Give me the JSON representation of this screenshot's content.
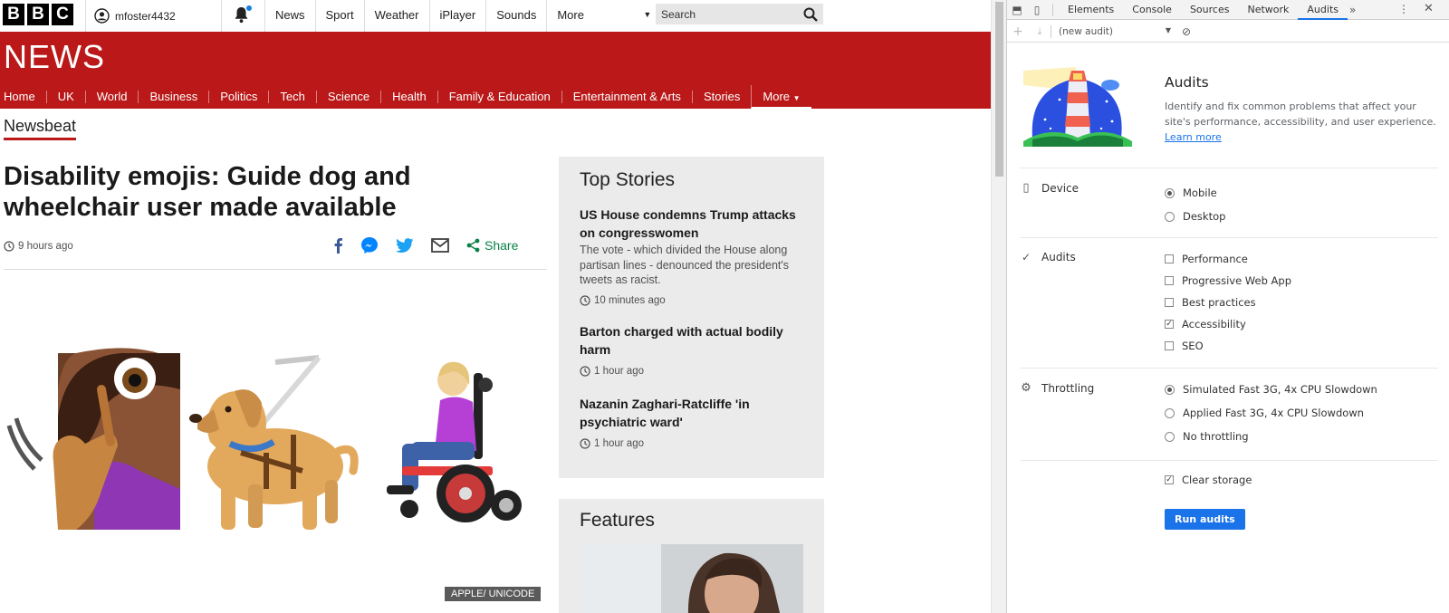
{
  "bbc": {
    "logo_letters": [
      "B",
      "B",
      "C"
    ],
    "account_name": "mfoster4432",
    "global_nav": [
      {
        "label": "News"
      },
      {
        "label": "Sport"
      },
      {
        "label": "Weather"
      },
      {
        "label": "iPlayer"
      },
      {
        "label": "Sounds"
      }
    ],
    "global_more": "More",
    "search_placeholder": "Search"
  },
  "news": {
    "logo_text": "NEWS",
    "brand_color": "#bb1919",
    "nav": [
      {
        "label": "Home"
      },
      {
        "label": "UK"
      },
      {
        "label": "World"
      },
      {
        "label": "Business"
      },
      {
        "label": "Politics"
      },
      {
        "label": "Tech"
      },
      {
        "label": "Science"
      },
      {
        "label": "Health"
      },
      {
        "label": "Family & Education"
      },
      {
        "label": "Entertainment & Arts"
      },
      {
        "label": "Stories"
      }
    ],
    "nav_more": "More"
  },
  "article": {
    "section": "Newsbeat",
    "headline": "Disability emojis: Guide dog and wheelchair user made available",
    "timestamp": "9 hours ago",
    "share_label": "Share",
    "image_credit": "APPLE/ UNICODE"
  },
  "top_stories": {
    "title": "Top Stories",
    "items": [
      {
        "title": "US House condemns Trump attacks on congresswomen",
        "summary": "The vote - which divided the House along partisan lines - denounced the president's tweets as racist.",
        "time": "10 minutes ago"
      },
      {
        "title": "Barton charged with actual bodily harm",
        "summary": "",
        "time": "1 hour ago"
      },
      {
        "title": "Nazanin Zaghari-Ratcliffe 'in psychiatric ward'",
        "summary": "",
        "time": "1 hour ago"
      }
    ]
  },
  "features": {
    "title": "Features"
  },
  "devtools": {
    "tabs": [
      "Elements",
      "Console",
      "Sources",
      "Network",
      "Audits"
    ],
    "active_tab": "Audits",
    "audit_select": "(new audit)",
    "panel_title": "Audits",
    "description": "Identify and fix common problems that affect your site's performance, accessibility, and user experience.",
    "learn_more": "Learn more",
    "device": {
      "label": "Device",
      "options": [
        {
          "label": "Mobile",
          "selected": true
        },
        {
          "label": "Desktop",
          "selected": false
        }
      ]
    },
    "audits": {
      "label": "Audits",
      "options": [
        {
          "label": "Performance",
          "checked": false
        },
        {
          "label": "Progressive Web App",
          "checked": false
        },
        {
          "label": "Best practices",
          "checked": false
        },
        {
          "label": "Accessibility",
          "checked": true
        },
        {
          "label": "SEO",
          "checked": false
        }
      ]
    },
    "throttling": {
      "label": "Throttling",
      "options": [
        {
          "label": "Simulated Fast 3G, 4x CPU Slowdown",
          "selected": true
        },
        {
          "label": "Applied Fast 3G, 4x CPU Slowdown",
          "selected": false
        },
        {
          "label": "No throttling",
          "selected": false
        }
      ]
    },
    "clear_storage": {
      "label": "Clear storage",
      "checked": true
    },
    "run_button": "Run audits",
    "accent_color": "#1a73e8"
  }
}
